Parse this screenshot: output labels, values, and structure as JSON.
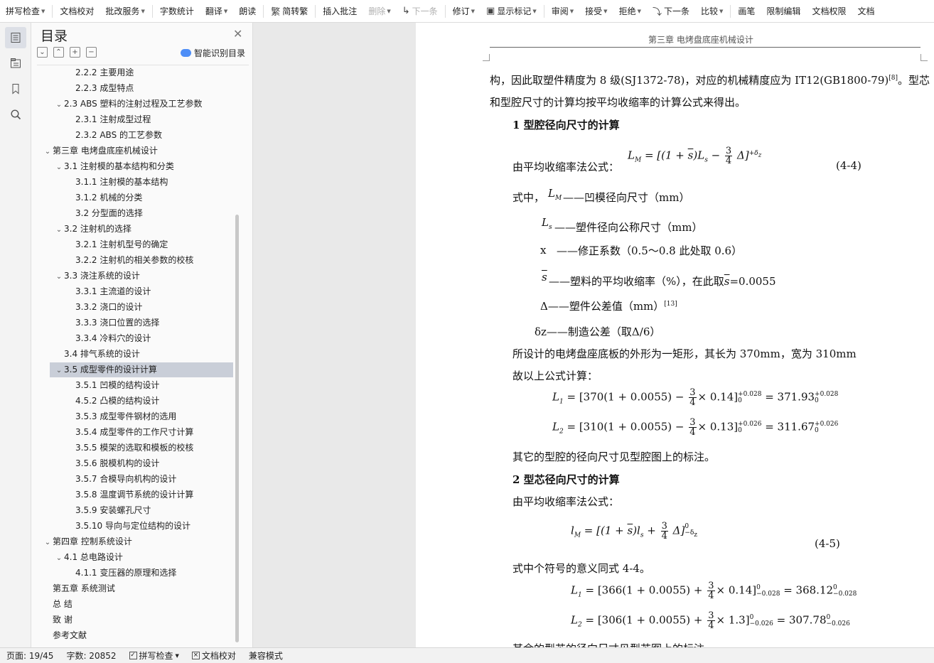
{
  "toolbar": {
    "items": [
      {
        "label": "拼写检查",
        "dropdown": true
      },
      {
        "label": "文档校对"
      },
      {
        "label": "批改服务",
        "dropdown": true
      },
      {
        "label": "字数统计"
      },
      {
        "label": "翻译",
        "dropdown": true
      },
      {
        "label": "朗读"
      },
      {
        "label": "简转繁",
        "icon": "simplified-to-traditional-icon"
      },
      {
        "label": "插入批注"
      },
      {
        "label": "删除",
        "dropdown": true,
        "disabled": true
      },
      {
        "label": "下一条",
        "disabled": true,
        "icon": "next-comment-icon"
      },
      {
        "label": "修订",
        "dropdown": true
      },
      {
        "label": "显示标记",
        "dropdown": true,
        "icon": "show-markup-icon"
      },
      {
        "label": "审阅",
        "dropdown": true
      },
      {
        "label": "接受",
        "dropdown": true
      },
      {
        "label": "拒绝",
        "dropdown": true
      },
      {
        "label": "下一条",
        "icon": "next-change-icon"
      },
      {
        "label": "比较",
        "dropdown": true
      },
      {
        "label": "画笔"
      },
      {
        "label": "限制编辑"
      },
      {
        "label": "文档权限"
      },
      {
        "label": "文档"
      }
    ]
  },
  "rail": {
    "icons": [
      "toc-icon",
      "navigation-icon",
      "bookmark-icon",
      "search-icon"
    ]
  },
  "toc": {
    "title": "目录",
    "smart_label": "智能识别目录",
    "tools": [
      "⌄",
      "⌃",
      "+",
      "−"
    ],
    "items": [
      {
        "text": "2.2.2  主要用途",
        "level": 3
      },
      {
        "text": "2.2.3  成型特点",
        "level": 3
      },
      {
        "text": "2.3 ABS 塑料的注射过程及工艺参数",
        "level": 2,
        "expanded": true
      },
      {
        "text": "2.3.1  注射成型过程",
        "level": 3
      },
      {
        "text": "2.3.2 ABS 的工艺参数",
        "level": 3
      },
      {
        "text": "第三章  电烤盘底座机械设计",
        "level": 1,
        "expanded": true
      },
      {
        "text": "3.1 注射模的基本结构和分类",
        "level": 2,
        "expanded": true
      },
      {
        "text": "3.1.1 注射模的基本结构",
        "level": 3
      },
      {
        "text": "3.1.2 机械的分类",
        "level": 3
      },
      {
        "text": "3.2 分型面的选择",
        "level": 3
      },
      {
        "text": "3.2 注射机的选择",
        "level": 2,
        "expanded": true
      },
      {
        "text": "3.2.1 注射机型号的确定",
        "level": 3
      },
      {
        "text": "3.2.2 注射机的相关参数的校核",
        "level": 3
      },
      {
        "text": "3.3 浇注系统的设计",
        "level": 2,
        "expanded": true
      },
      {
        "text": "3.3.1  主流道的设计",
        "level": 3
      },
      {
        "text": "3.3.2  浇口的设计",
        "level": 3
      },
      {
        "text": "3.3.3  浇口位置的选择",
        "level": 3
      },
      {
        "text": "3.3.4  冷料穴的设计",
        "level": 3
      },
      {
        "text": "3.4  排气系统的设计",
        "level": 2
      },
      {
        "text": "3.5  成型零件的设计计算",
        "level": 2,
        "expanded": true,
        "selected": true
      },
      {
        "text": "3.5.1 凹模的结构设计",
        "level": 3
      },
      {
        "text": "4.5.2  凸模的结构设计",
        "level": 3
      },
      {
        "text": "3.5.3  成型零件钢材的选用",
        "level": 3
      },
      {
        "text": "3.5.4  成型零件的工作尺寸计算",
        "level": 3
      },
      {
        "text": "3.5.5  模架的选取和模板的校核",
        "level": 3
      },
      {
        "text": "3.5.6  脱模机构的设计",
        "level": 3
      },
      {
        "text": "3.5.7 合模导向机构的设计",
        "level": 3
      },
      {
        "text": "3.5.8  温度调节系统的设计计算",
        "level": 3
      },
      {
        "text": "3.5.9  安装螺孔尺寸",
        "level": 3
      },
      {
        "text": "3.5.10  导向与定位结构的设计",
        "level": 3
      },
      {
        "text": "第四章  控制系统设计",
        "level": 1,
        "expanded": true
      },
      {
        "text": "4.1 总电路设计",
        "level": 2,
        "expanded": true
      },
      {
        "text": "4.1.1 变压器的原理和选择",
        "level": 3
      },
      {
        "text": "第五章  系统测试",
        "level": 1
      },
      {
        "text": "总    结",
        "level": 1
      },
      {
        "text": "致    谢",
        "level": 1
      },
      {
        "text": "参考文献",
        "level": 1
      }
    ]
  },
  "doc": {
    "header": "第三章   电烤盘底座机械设计",
    "p1a": "构，因此取塑件精度为 8 级(SJ1372-78)，对应的机械精度应为 IT12(GB1800-79)",
    "p1_ref": "[8]",
    "p1b": "。型芯",
    "p2": "和型腔尺寸的计算均按平均收缩率的计算公式来得出。",
    "h1": "1  型腔径向尺寸的计算",
    "formula_intro_1": "由平均收缩率法公式：",
    "eq1_no": "(4-4)",
    "where_prefix": "式中，",
    "def_LM": "——凹模径向尺寸（mm）",
    "def_Ls": "——塑件径向公称尺寸（mm）",
    "def_x_sym": "x",
    "def_x": "——修正系数（0.5～0.8 此处取 0.6）",
    "def_s_a": "——塑料的平均收缩率（%），在此取",
    "def_s_b": "=0.0055",
    "def_delta": "Δ——塑件公差值（mm）",
    "def_delta_ref": "[13]",
    "def_dz": "δz——制造公差（取Δ/6）",
    "p_dims": "所设计的电烤盘座底板的外形为一矩形，其长为 370mm，宽为 310mm",
    "p_calc": "故以上公式计算：",
    "p_other1": "其它的型腔的径向尺寸见型腔图上的标注。",
    "h2": "2  型芯径向尺寸的计算",
    "formula_intro_2": "由平均收缩率法公式：",
    "eq2_no": "(4-5)",
    "p_same": "式中个符号的意义同式 4-4。",
    "p_other2": "其余的型芯的径向尺寸见型芯图上的标注",
    "eq": {
      "L1a": "[370(1 + 0.0055) −",
      "L1b": "× 0.14]",
      "L1c": "= 371.93",
      "L2a": "[310(1 + 0.0055) −",
      "L2b": "× 0.13]",
      "L2c": "= 311.67",
      "l1a": "[366(1 + 0.0055) +",
      "l1b": "× 0.14]",
      "l1c": "= 368.12",
      "l2a": "[306(1 + 0.0055) +",
      "l2b": "× 1.3]",
      "l2c": "= 307.78"
    }
  },
  "status": {
    "page": "页面: 19/45",
    "words": "字数: 20852",
    "spell": "拼写检查",
    "proof": "文档校对",
    "compat": "兼容模式"
  }
}
